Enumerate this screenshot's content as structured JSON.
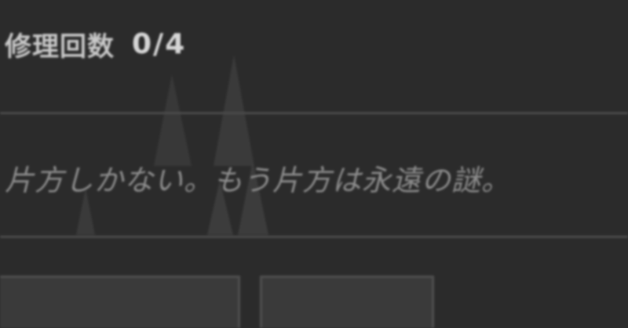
{
  "status": {
    "repair_label": "修理回数",
    "repair_count": "0/4"
  },
  "message": "片方しかない。もう片方は永遠の謎。",
  "buttons": {
    "left_label": "",
    "right_label": ""
  },
  "colors": {
    "background": "#2b2b2b",
    "text_primary": "#c9c9c9",
    "text_message": "#8c8c8c",
    "divider": "#4a4a4a",
    "button_border": "#4e4e4e",
    "button_fill": "#3a3a3a",
    "spike": "#3a3a3a"
  }
}
